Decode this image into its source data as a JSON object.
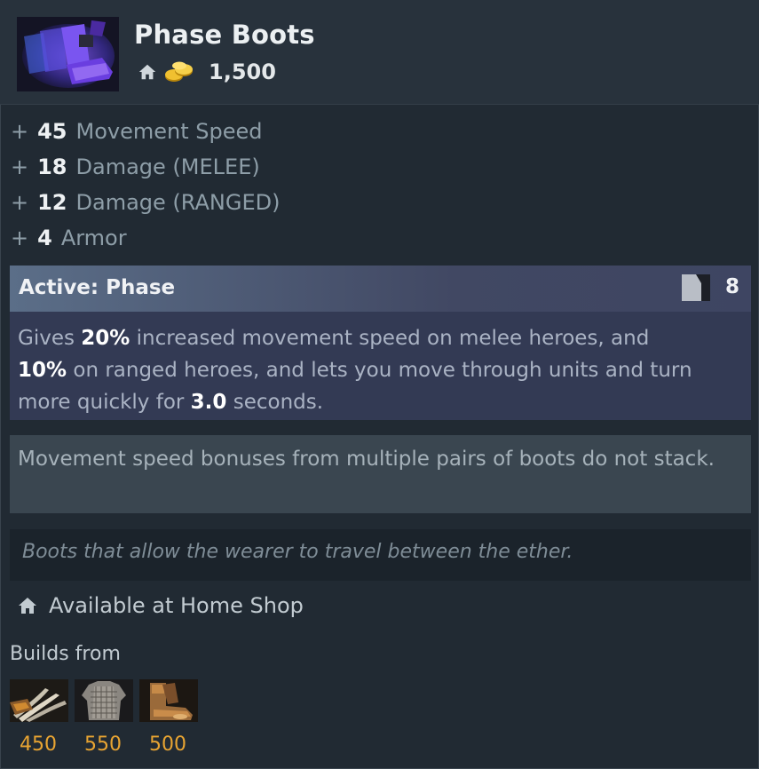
{
  "item": {
    "name": "Phase Boots",
    "icon": "phase-boots-icon",
    "cost": "1,500"
  },
  "attributes": [
    {
      "sign": "+",
      "value": "45",
      "label": "Movement Speed"
    },
    {
      "sign": "+",
      "value": "18",
      "label": "Damage (MELEE)"
    },
    {
      "sign": "+",
      "value": "12",
      "label": "Damage (RANGED)"
    },
    {
      "sign": "+",
      "value": "4",
      "label": "Armor"
    }
  ],
  "active": {
    "title": "Active: Phase",
    "cooldown": "8",
    "desc_1": "Gives ",
    "melee_pct": "20%",
    "desc_2": " increased movement speed on melee heroes, and",
    "ranged_pct": "10%",
    "desc_3": " on ranged heroes, and lets you move through units and turn more quickly for ",
    "duration": "3.0",
    "desc_4": " seconds."
  },
  "note": "Movement speed bonuses from multiple pairs of boots do not stack.",
  "lore": "Boots that allow the wearer to travel between the ether.",
  "shop": "Available at Home Shop",
  "builds": {
    "label": "Builds from",
    "components": [
      {
        "icon": "blades-of-attack-icon",
        "cost": "450"
      },
      {
        "icon": "chainmail-icon",
        "cost": "550"
      },
      {
        "icon": "boots-of-speed-icon",
        "cost": "500"
      }
    ]
  },
  "colors": {
    "background": "#212a33",
    "gold": "#e8a432",
    "active_header": "#414863",
    "active_body": "#333a54"
  }
}
